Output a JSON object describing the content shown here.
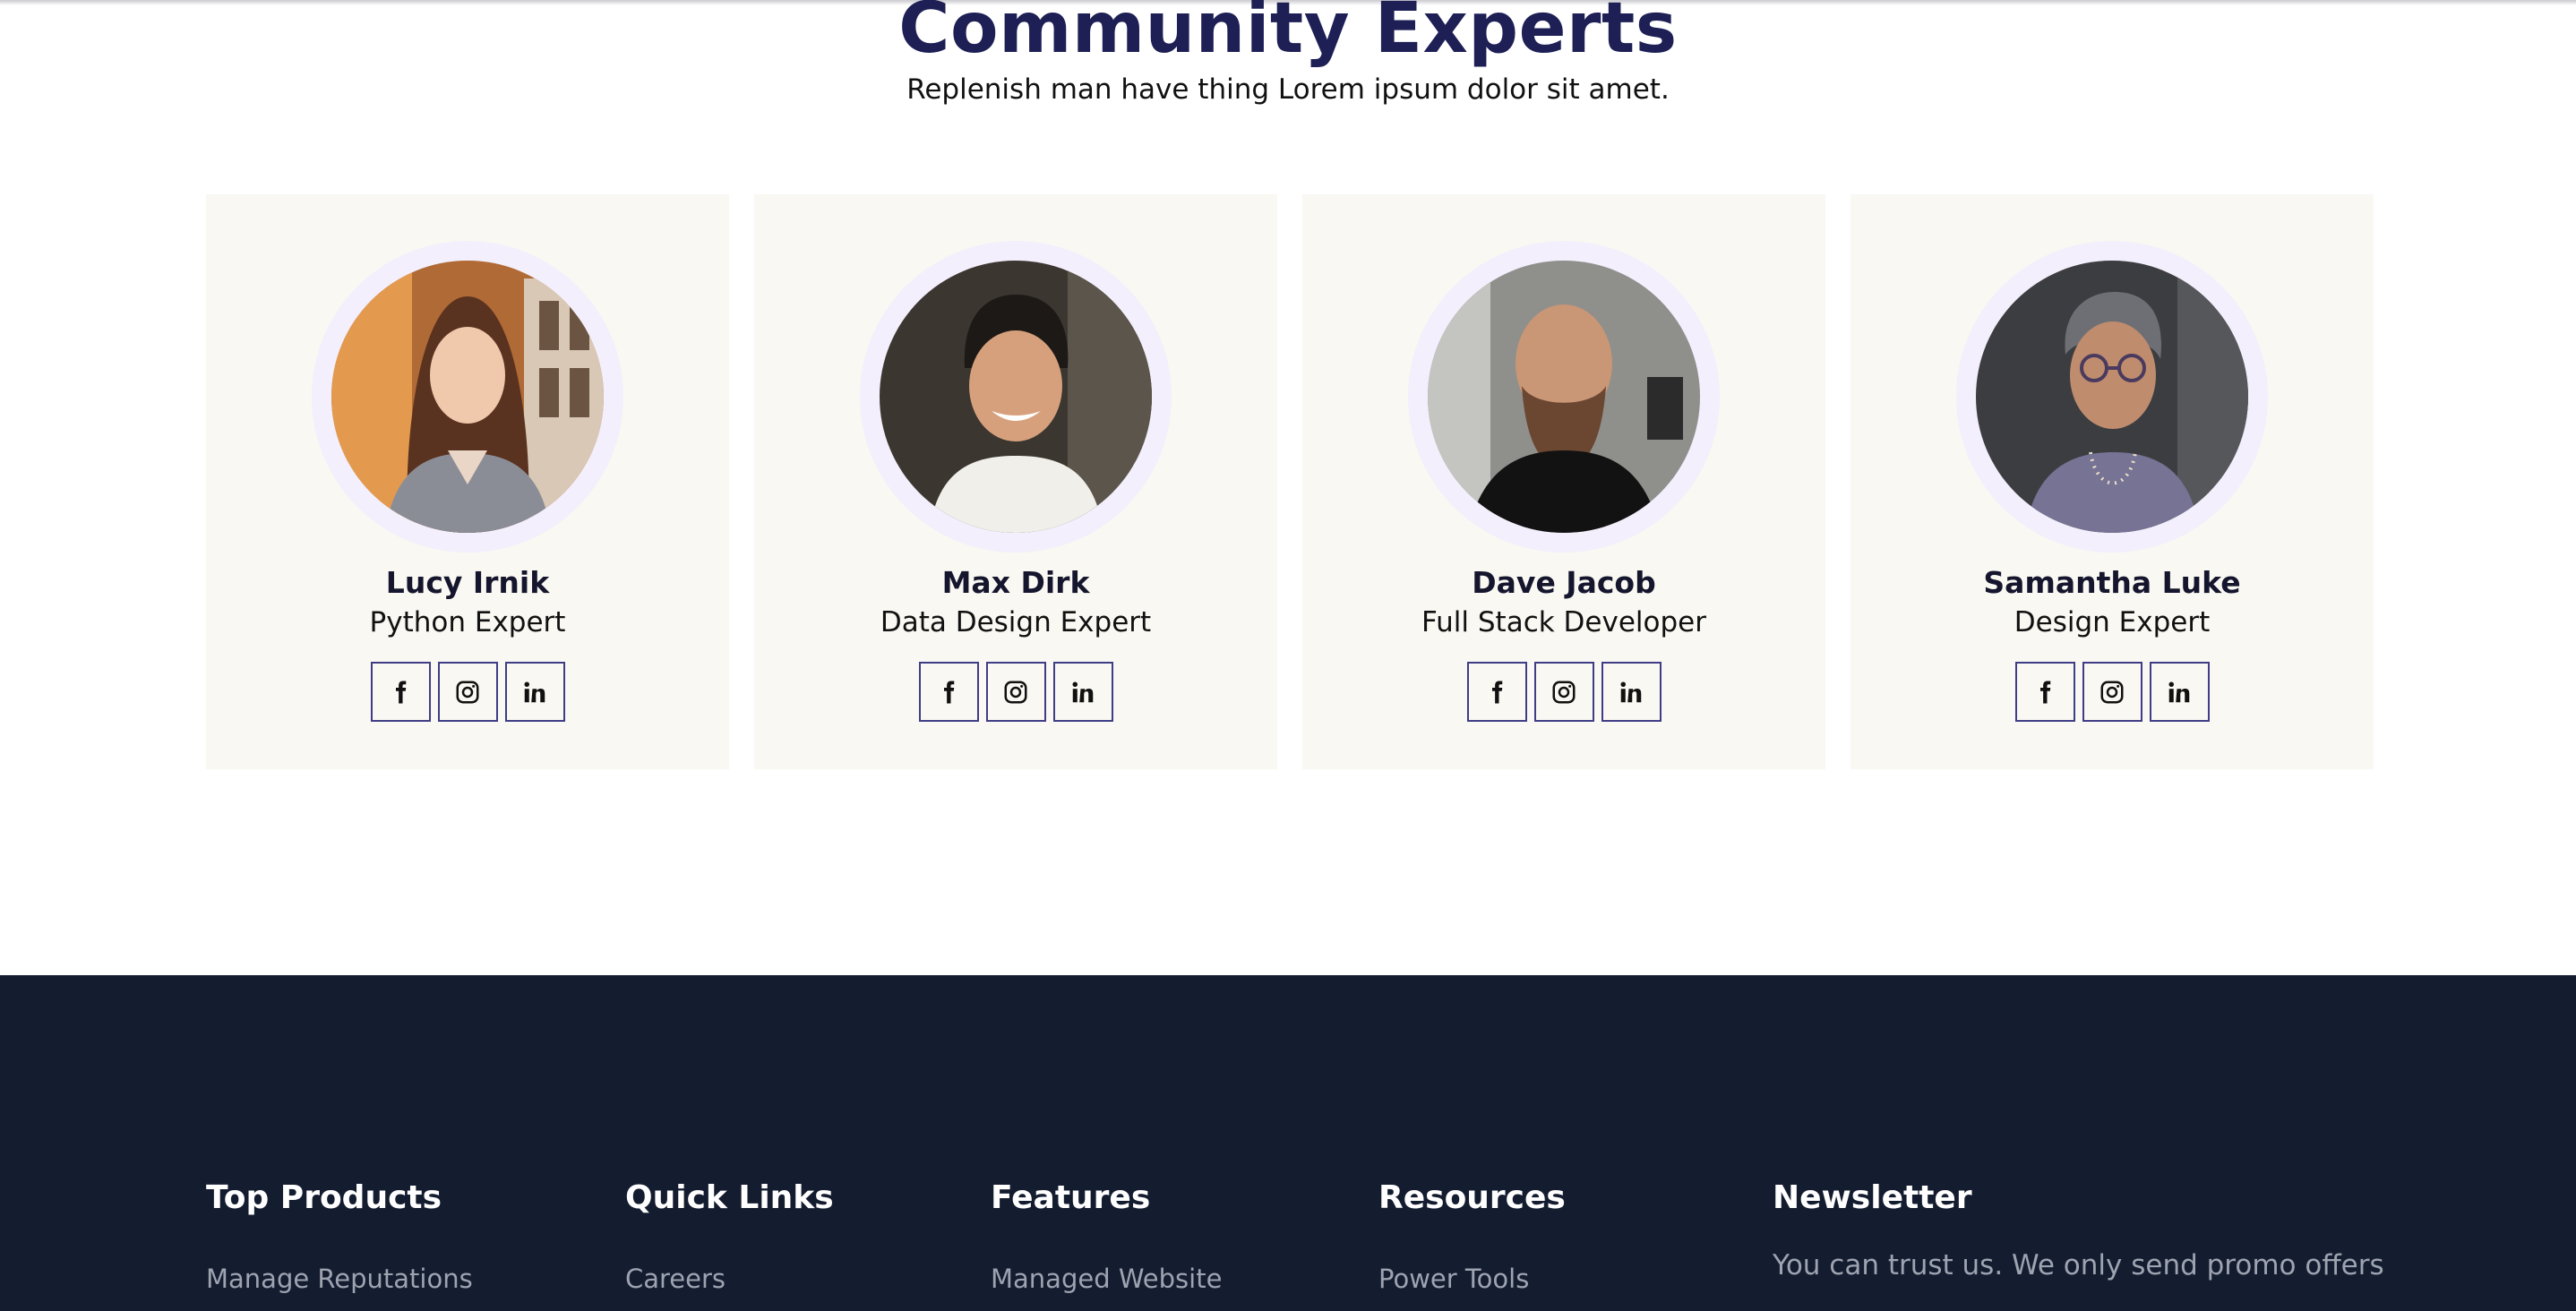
{
  "section": {
    "title": "Community Experts",
    "subtitle": "Replenish man have thing Lorem ipsum dolor sit amet."
  },
  "experts": [
    {
      "name": "Lucy Irnik",
      "role": "Python Expert"
    },
    {
      "name": "Max Dirk",
      "role": "Data Design Expert"
    },
    {
      "name": "Dave Jacob",
      "role": "Full Stack Developer"
    },
    {
      "name": "Samantha Luke",
      "role": "Design Expert"
    }
  ],
  "social_icons": [
    "facebook-icon",
    "instagram-icon",
    "linkedin-icon"
  ],
  "footer": {
    "columns": [
      {
        "heading": "Top Products",
        "first_link": "Manage Reputations"
      },
      {
        "heading": "Quick Links",
        "first_link": "Careers"
      },
      {
        "heading": "Features",
        "first_link": "Managed Website"
      },
      {
        "heading": "Resources",
        "first_link": "Power Tools"
      }
    ],
    "newsletter": {
      "heading": "Newsletter",
      "text": "You can trust us. We only send promo offers"
    }
  },
  "colors": {
    "title": "#1d1f55",
    "card_background": "#f9f8f2",
    "avatar_ring": "#f3effc",
    "social_border": "#3f3d86",
    "footer_background": "#141c30",
    "footer_link": "#9ea3b0"
  }
}
